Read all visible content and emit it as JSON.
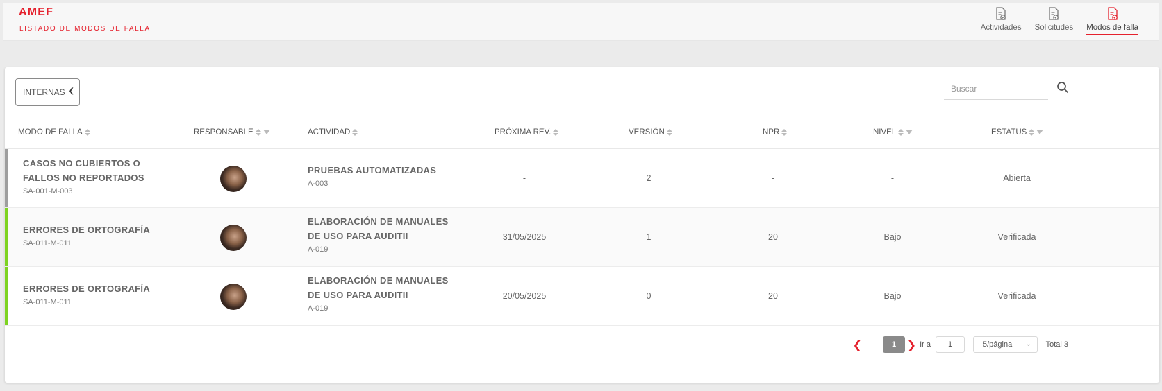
{
  "header": {
    "title": "AMEF",
    "subtitle": "LISTADO DE MODOS DE FALLA",
    "nav": [
      {
        "label": "Actividades",
        "icon": "document-check-icon",
        "active": false
      },
      {
        "label": "Solicitudes",
        "icon": "document-check-icon",
        "active": false
      },
      {
        "label": "Modos de falla",
        "icon": "document-check-icon",
        "active": true
      }
    ],
    "accent_color": "#e5212d"
  },
  "toolbar": {
    "filter_value": "INTERNAS",
    "search_placeholder": "Buscar"
  },
  "table": {
    "columns": [
      "MODO DE FALLA",
      "RESPONSABLE",
      "ACTIVIDAD",
      "PRÓXIMA REV.",
      "VERSIÓN",
      "NPR",
      "NIVEL",
      "ESTATUS"
    ],
    "rows": [
      {
        "name_line1": "CASOS NO CUBIERTOS O",
        "name_line2": "FALLOS NO REPORTADOS",
        "code": "SA-001-M-003",
        "activity_line1": "PRUEBAS AUTOMATIZADAS",
        "activity_line2": "",
        "activity_code": "A-003",
        "next_rev": "-",
        "version": "2",
        "npr": "-",
        "level": "-",
        "status": "Abierta",
        "status_color": "#9e9e9e"
      },
      {
        "name_line1": "ERRORES DE ORTOGRAFÍA",
        "name_line2": "",
        "code": "SA-011-M-011",
        "activity_line1": "ELABORACIÓN DE MANUALES",
        "activity_line2": "DE USO PARA AUDITII",
        "activity_code": "A-019",
        "next_rev": "31/05/2025",
        "version": "1",
        "npr": "20",
        "level": "Bajo",
        "status": "Verificada",
        "status_color": "#7ed321"
      },
      {
        "name_line1": "ERRORES DE ORTOGRAFÍA",
        "name_line2": "",
        "code": "SA-011-M-011",
        "activity_line1": "ELABORACIÓN DE MANUALES",
        "activity_line2": "DE USO PARA AUDITII",
        "activity_code": "A-019",
        "next_rev": "20/05/2025",
        "version": "0",
        "npr": "20",
        "level": "Bajo",
        "status": "Verificada",
        "status_color": "#7ed321"
      }
    ]
  },
  "pagination": {
    "current_page": "1",
    "goto_label": "Ir a",
    "goto_value": "1",
    "page_size": "5/página",
    "total": "Total 3"
  }
}
